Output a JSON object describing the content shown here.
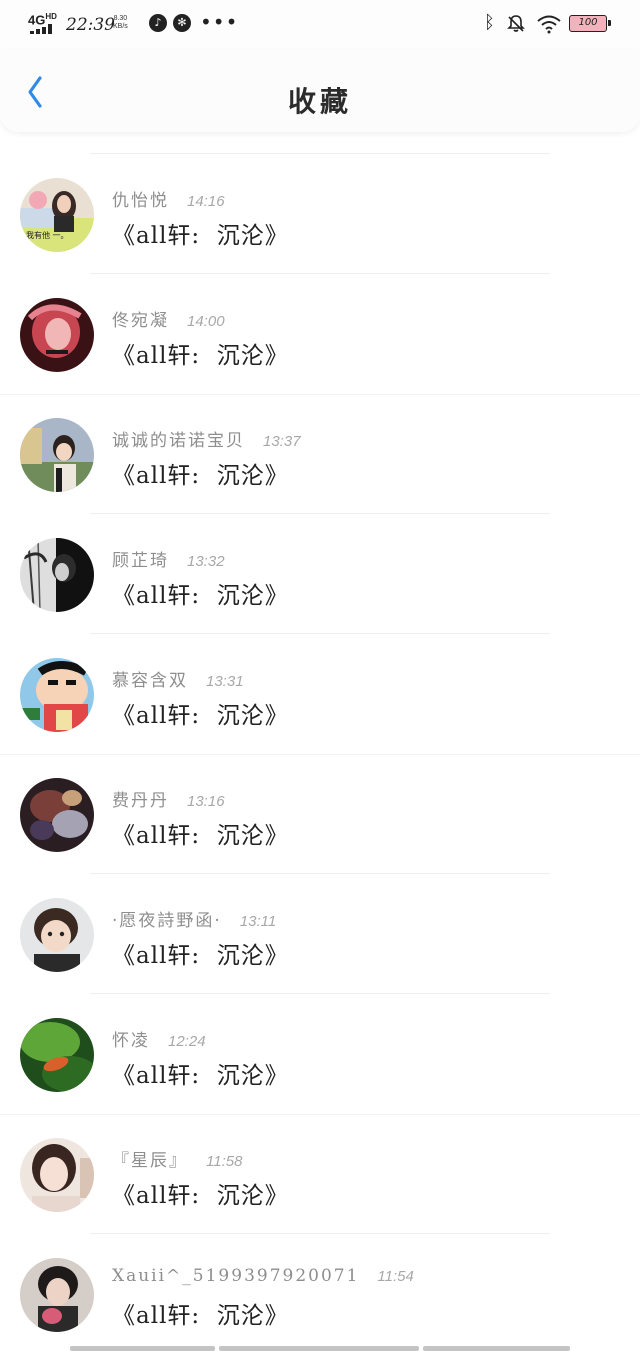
{
  "status_bar": {
    "network": "4G",
    "network_sup": "HD",
    "time": "22:39",
    "speed_value": "8.30",
    "speed_unit": "KB/s",
    "battery": "100"
  },
  "header": {
    "title": "收藏"
  },
  "colors": {
    "accent": "#2f8be6",
    "battery_fill": "#f3b3bd",
    "name_gray": "#8e8e8e"
  },
  "list": {
    "items": [
      {
        "name": "仇怡悦",
        "time": "14:16",
        "message": "《all轩:  沉沦》",
        "avatar_caption": "我有他  一。"
      },
      {
        "name": "佟宛凝",
        "time": "14:00",
        "message": "《all轩:  沉沦》"
      },
      {
        "name": "诚诚的诺诺宝贝",
        "time": "13:37",
        "message": "《all轩:  沉沦》"
      },
      {
        "name": "顾芷琦",
        "time": "13:32",
        "message": "《all轩:  沉沦》"
      },
      {
        "name": "慕容含双",
        "time": "13:31",
        "message": "《all轩:  沉沦》"
      },
      {
        "name": "费丹丹",
        "time": "13:16",
        "message": "《all轩:  沉沦》"
      },
      {
        "name": "·愿夜詩野函·",
        "time": "13:11",
        "message": "《all轩:  沉沦》"
      },
      {
        "name": "怀凌",
        "time": "12:24",
        "message": "《all轩:  沉沦》"
      },
      {
        "name": "『星辰』",
        "time": "11:58",
        "message": "《all轩:  沉沦》"
      },
      {
        "name": "Xauii^_5199397920071",
        "time": "11:54",
        "message": "《all轩:  沉沦》"
      }
    ]
  }
}
